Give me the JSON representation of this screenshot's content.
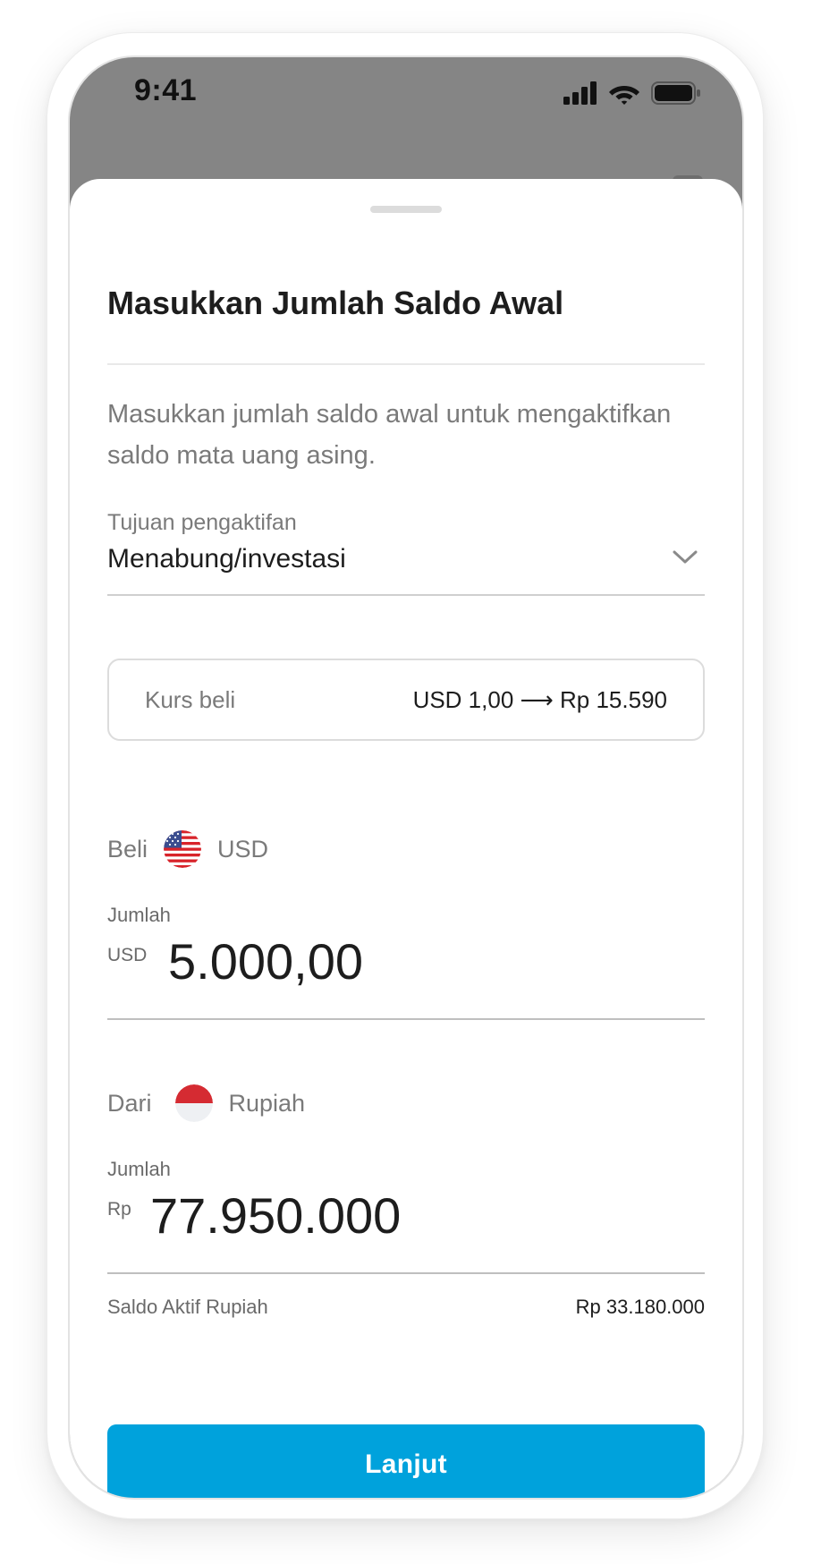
{
  "status_bar": {
    "time": "9:41",
    "signal_icon": "cellular-signal-icon",
    "wifi_icon": "wifi-icon",
    "battery_icon": "battery-icon"
  },
  "sheet": {
    "title": "Masukkan Jumlah Saldo Awal",
    "description": "Masukkan jumlah saldo awal untuk mengaktifkan saldo mata uang asing.",
    "purpose": {
      "label": "Tujuan pengaktifan",
      "value": "Menabung/investasi",
      "icon": "chevron-down-icon"
    },
    "rate": {
      "label": "Kurs beli",
      "value": "USD 1,00 ⟶ Rp 15.590"
    },
    "buy": {
      "prefix": "Beli",
      "currency": "USD",
      "flag": "us-flag-icon",
      "amount_label": "Jumlah",
      "amount_currency": "USD",
      "amount": "5.000,00"
    },
    "from": {
      "prefix": "Dari",
      "currency": "Rupiah",
      "flag": "id-flag-icon",
      "amount_label": "Jumlah",
      "amount_currency": "Rp",
      "amount": "77.950.000"
    },
    "balance": {
      "label": "Saldo Aktif Rupiah",
      "value": "Rp 33.180.000"
    },
    "cta_label": "Lanjut"
  },
  "colors": {
    "accent": "#00a2dc",
    "backdrop": "#858585",
    "text": "#1d1d1d",
    "muted": "#7a7a7a"
  }
}
